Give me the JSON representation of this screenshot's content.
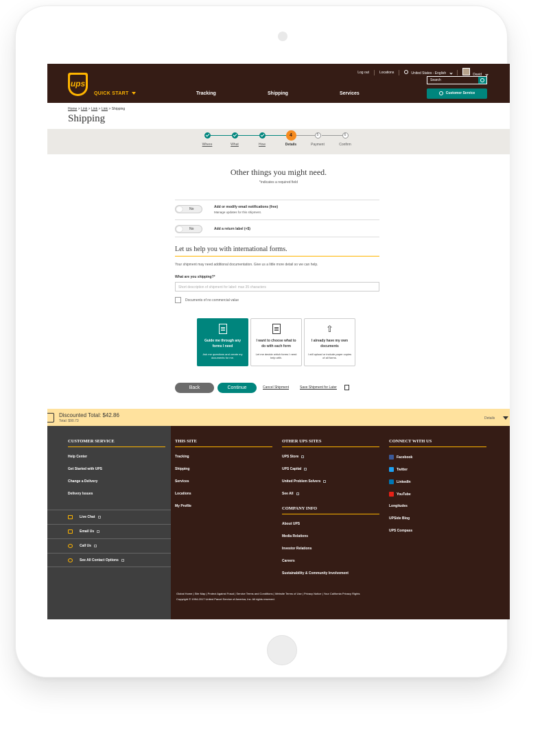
{
  "header": {
    "logo_text": "ups",
    "quick_start": "QUICK START",
    "nav": [
      "Tracking",
      "Shipping",
      "Services"
    ],
    "top_links": {
      "logout": "Log out",
      "locations": "Locations",
      "language": "United States - English",
      "user": "David"
    },
    "search_placeholder": "Search",
    "customer_service": "Customer Service"
  },
  "breadcrumb": {
    "items": [
      "Home",
      "Link",
      "Link",
      "Link"
    ],
    "current": "Shipping"
  },
  "page_title": "Shipping",
  "stepper": {
    "steps": [
      {
        "label": "Where",
        "state": "done"
      },
      {
        "label": "What",
        "state": "done"
      },
      {
        "label": "How",
        "state": "done"
      },
      {
        "label": "Details",
        "state": "current",
        "num": "4"
      },
      {
        "label": "Payment",
        "state": "todo",
        "num": "5"
      },
      {
        "label": "Confirm",
        "state": "todo",
        "num": "6"
      }
    ]
  },
  "main": {
    "heading": "Other things you might need.",
    "required_note": "*indicates a required field",
    "options": [
      {
        "toggle": "No",
        "title": "Add or modify email notifications (free)",
        "subtitle": "Manage updates for this shipment."
      },
      {
        "toggle": "No",
        "title": "Add a return label (+$)",
        "subtitle": ""
      }
    ],
    "forms_heading": "Let us help you with international forms.",
    "forms_para": "Your shipment may need additional documentation. Give us a little more detail so we can help.",
    "field_label": "What are you shipping?*",
    "field_placeholder": "Short description of shipment for label: max 35 characters",
    "checkbox_label": "Documents of no commercial value",
    "cards": [
      {
        "title": "Guide me through any forms I need",
        "sub": "Ask me questions and create my documents for me.",
        "icon": "document-icon",
        "selected": true
      },
      {
        "title": "I want to choose what to do with each form",
        "sub": "Let me decide which forms I need help with.",
        "icon": "document-icon",
        "selected": false
      },
      {
        "title": "I already have my own documents",
        "sub": "I will upload or include paper copies of all forms.",
        "icon": "upload-icon",
        "selected": false
      }
    ],
    "back": "Back",
    "continue": "Continue",
    "cancel": "Cancel Shipment",
    "save_later": "Save Shipment for Later"
  },
  "total_bar": {
    "label": "Discounted Total: $42.86",
    "sub": "Total: $90.73",
    "details": "Details"
  },
  "footer": {
    "customer_service": {
      "title": "CUSTOMER SERVICE",
      "items": [
        "Help Center",
        "Get Started with UPS",
        "Change a Delivery",
        "Delivery Issues"
      ]
    },
    "contacts": [
      "Live Chat",
      "Email Us",
      "Call Us",
      "See All Contact Options"
    ],
    "this_site": {
      "title": "THIS SITE",
      "items": [
        "Tracking",
        "Shipping",
        "Services",
        "Locations",
        "My Profile"
      ]
    },
    "other_sites": {
      "title": "OTHER UPS SITES",
      "items": [
        "UPS Store",
        "UPS Capital",
        "United Problem Solvers",
        "See All"
      ]
    },
    "company_info": {
      "title": "COMPANY INFO",
      "items": [
        "About UPS",
        "Media Relations",
        "Investor Relations",
        "Careers",
        "Sustainability & Community Involvement"
      ]
    },
    "connect": {
      "title": "CONNECT WITH US",
      "items": [
        "Facebook",
        "Twitter",
        "LinkedIn",
        "YouTube",
        "Longitudes",
        "UPSide Blog",
        "UPS Compass"
      ]
    },
    "legal_links": "Global Home  |  Site Map  |  Protect Against Fraud  |  Service Terms and Conditions  |  Website Terms of Use  |  Privacy Notice  |  Your California Privacy Rights",
    "copyright": "Copyright © 1994-2017 United Parcel Service of America, Inc. All rights reserved."
  },
  "colors": {
    "brown": "#351c15",
    "gold": "#ffb500",
    "teal": "#00857d",
    "orange": "#f68b1f",
    "bar": "#ffe29e"
  }
}
